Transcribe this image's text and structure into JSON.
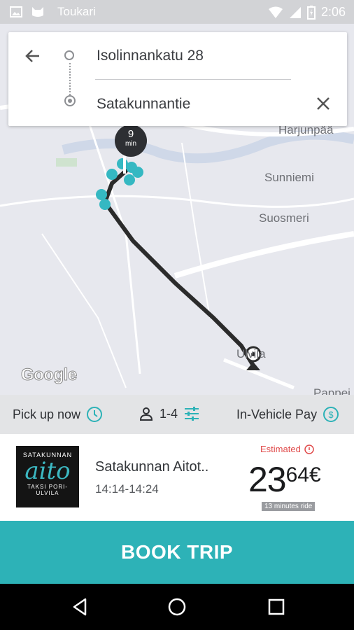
{
  "status_bar": {
    "carrier": "Toukari",
    "time": "2:06"
  },
  "search": {
    "from_value": "Isolinnankatu 28",
    "to_value": "Satakunnantie"
  },
  "map": {
    "eta_value": "9",
    "eta_unit": "min",
    "labels": [
      "Harjunpää",
      "Sunniemi",
      "Suosmeri",
      "Ulvila",
      "Pappei"
    ],
    "attribution": "Google",
    "route_color": "#2b2b2b",
    "marker_color": "#35b8c2"
  },
  "options": {
    "pickup_label": "Pick up now",
    "passengers_label": "1-4",
    "payment_label": "In-Vehicle Pay"
  },
  "provider": {
    "logo_top": "SATAKUNNAN",
    "logo_mid": "aito",
    "logo_bottom": "TAKSI PORI-ULVILA",
    "name": "Satakunnan Aitot..",
    "time_range": "14:14-14:24",
    "estimated_label": "Estimated",
    "price_main": "23",
    "price_decimal": "64€",
    "ride_duration": "13 minutes ride"
  },
  "actions": {
    "book_label": "BOOK TRIP"
  },
  "colors": {
    "accent": "#2db2b7",
    "warning": "#e04a4a"
  }
}
